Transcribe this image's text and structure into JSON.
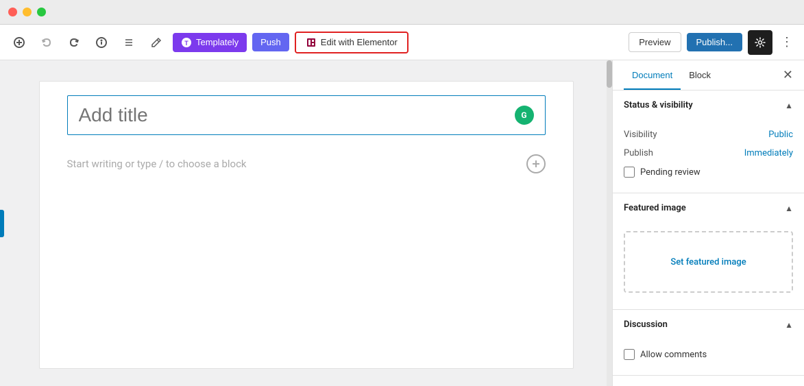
{
  "titlebar": {
    "traffic": [
      "red",
      "yellow",
      "green"
    ]
  },
  "toolbar": {
    "undo_label": "↺",
    "redo_label": "↻",
    "info_label": "ℹ",
    "list_label": "☰",
    "pencil_label": "✎",
    "templately_label": "Templately",
    "push_label": "Push",
    "elementor_label": "Edit with Elementor",
    "preview_label": "Preview",
    "publish_label": "Publish...",
    "settings_label": "⚙",
    "more_label": "⋮"
  },
  "editor": {
    "title_placeholder": "Add title",
    "block_hint": "Start writing or type / to choose a block"
  },
  "sidebar": {
    "tab_document": "Document",
    "tab_block": "Block",
    "close_label": "✕",
    "status_visibility": {
      "section_title": "Status & visibility",
      "visibility_label": "Visibility",
      "visibility_value": "Public",
      "publish_label": "Publish",
      "publish_value": "Immediately",
      "pending_review_label": "Pending review"
    },
    "featured_image": {
      "section_title": "Featured image",
      "set_image_label": "Set featured image"
    },
    "discussion": {
      "section_title": "Discussion",
      "allow_comments_label": "Allow comments"
    }
  }
}
